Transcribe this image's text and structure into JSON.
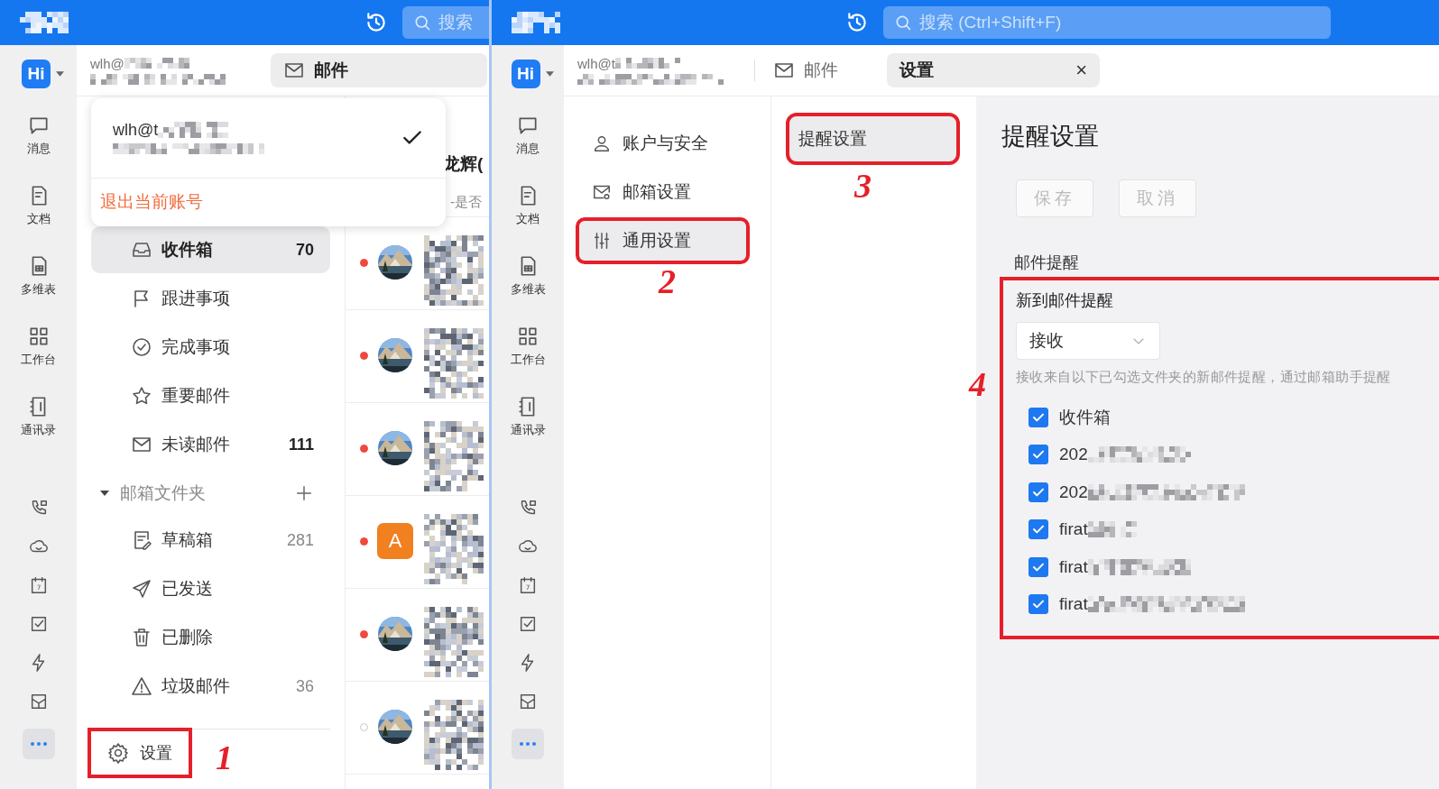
{
  "left": {
    "topbar": {
      "search": {
        "placeholder": "搜索"
      }
    },
    "rail": {
      "brand": "Hi",
      "apps": [
        {
          "kind": "chat",
          "label": "消息"
        },
        {
          "kind": "doc",
          "label": "文档"
        },
        {
          "kind": "sheet",
          "label": "多维表"
        },
        {
          "kind": "grid",
          "label": "工作台"
        },
        {
          "kind": "contacts",
          "label": "通讯录"
        }
      ],
      "tools": [
        {
          "kind": "phone"
        },
        {
          "kind": "cloud"
        },
        {
          "kind": "calendar",
          "day": "7"
        },
        {
          "kind": "check-square"
        },
        {
          "kind": "bolt"
        },
        {
          "kind": "box"
        }
      ]
    },
    "account": {
      "name": "wlh@"
    },
    "tabs": [
      {
        "label": "邮件",
        "selected": true
      }
    ],
    "account_menu": {
      "account": "wlh@t",
      "checked": true,
      "logout": "退出当前账号"
    },
    "folders": [
      {
        "kind": "inbox",
        "label": "收件箱",
        "count": "70",
        "count_strong": true,
        "selected": true
      },
      {
        "kind": "flag",
        "label": "跟进事项",
        "selected": false
      },
      {
        "kind": "check-circle",
        "label": "完成事项",
        "selected": false
      },
      {
        "kind": "star",
        "label": "重要邮件",
        "selected": false
      },
      {
        "kind": "mail",
        "label": "未读邮件",
        "count": "111",
        "count_strong": true,
        "selected": false
      }
    ],
    "folder_group": {
      "label": "邮箱文件夹",
      "expanded": true,
      "children": [
        {
          "kind": "draft",
          "label": "草稿箱",
          "count": "281",
          "count_strong": false,
          "selected": false
        },
        {
          "kind": "send",
          "label": "已发送",
          "selected": false
        },
        {
          "kind": "trash",
          "label": "已删除",
          "selected": false
        },
        {
          "kind": "warning",
          "label": "垃圾邮件",
          "count": "36",
          "count_strong": false,
          "selected": false
        }
      ]
    },
    "settings_button": {
      "label": "设置",
      "annotation": "1"
    },
    "mail_list": {
      "first_sender": "龙辉(",
      "first_preview": "-是否",
      "rows": [
        {
          "unread": true,
          "kind": "picture"
        },
        {
          "unread": true,
          "kind": "picture"
        },
        {
          "unread": true,
          "kind": "picture"
        },
        {
          "unread": true,
          "kind": "letter",
          "letter": "A"
        },
        {
          "unread": true,
          "kind": "picture"
        },
        {
          "unread": false,
          "kind": "picture"
        }
      ]
    }
  },
  "right": {
    "topbar": {
      "search": {
        "placeholder": "搜索 (Ctrl+Shift+F)"
      }
    },
    "rail": {
      "brand": "Hi",
      "apps": [
        {
          "kind": "chat",
          "label": "消息"
        },
        {
          "kind": "doc",
          "label": "文档"
        },
        {
          "kind": "sheet",
          "label": "多维表"
        },
        {
          "kind": "grid",
          "label": "工作台"
        },
        {
          "kind": "contacts",
          "label": "通讯录"
        }
      ],
      "tools": [
        {
          "kind": "phone"
        },
        {
          "kind": "cloud"
        },
        {
          "kind": "calendar",
          "day": "7"
        },
        {
          "kind": "check-square"
        },
        {
          "kind": "bolt"
        },
        {
          "kind": "box"
        }
      ]
    },
    "account": {
      "name": "wlh@t"
    },
    "tabs": [
      {
        "label": "邮件",
        "selected": false
      },
      {
        "label": "设置",
        "selected": true,
        "close": "×"
      }
    ],
    "settings_nav": [
      {
        "kind": "user",
        "label": "账户与安全",
        "selected": false
      },
      {
        "kind": "mail-gear",
        "label": "邮箱设置",
        "selected": false
      },
      {
        "kind": "sliders",
        "label": "通用设置",
        "selected": true,
        "annotation": "2"
      }
    ],
    "sub_nav": [
      {
        "label": "提醒设置",
        "selected": true,
        "annotation": "3"
      }
    ],
    "content": {
      "title": "提醒设置",
      "buttons": [
        {
          "label": "保存",
          "disabled": true
        },
        {
          "label": "取消",
          "disabled": true
        }
      ],
      "section": "邮件提醒",
      "group": {
        "annotation": "4",
        "label": "新到邮件提醒",
        "select": {
          "value": "接收"
        },
        "hint": "接收来自以下已勾选文件夹的新邮件提醒，通过邮箱助手提醒",
        "folders": [
          {
            "label": "收件箱",
            "checked": true,
            "redacted": false
          },
          {
            "label": "202",
            "checked": true,
            "redacted": true
          },
          {
            "label": "202",
            "checked": true,
            "redacted": true
          },
          {
            "label": "firat",
            "checked": true,
            "redacted": true
          },
          {
            "label": "firat",
            "checked": true,
            "redacted": true
          },
          {
            "label": "firat",
            "checked": true,
            "redacted": true
          }
        ]
      }
    }
  }
}
